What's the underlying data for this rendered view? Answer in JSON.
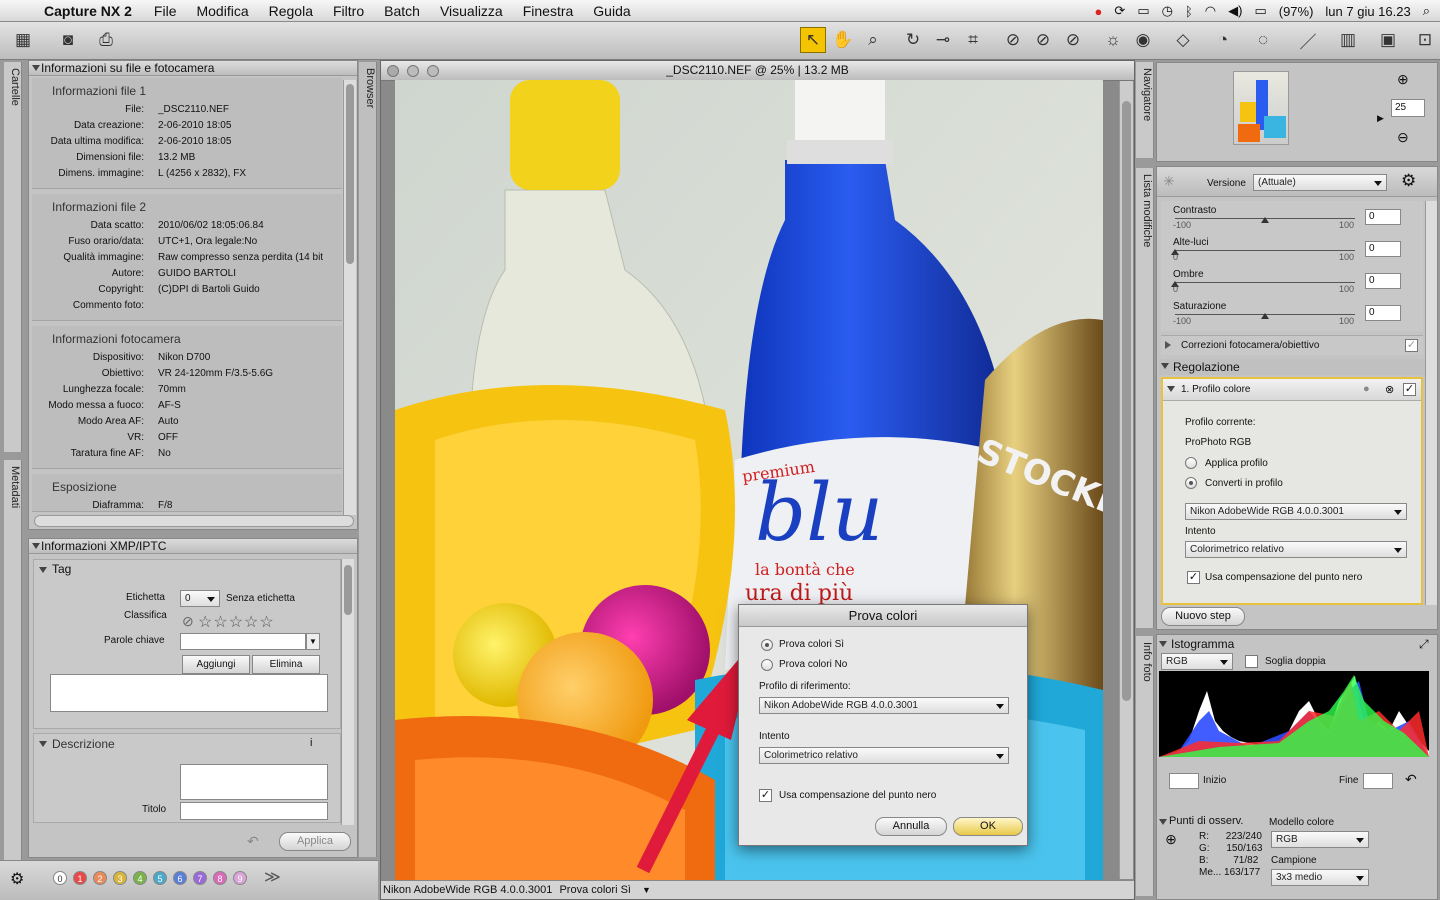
{
  "menubar": {
    "app": "Capture NX 2",
    "items": [
      "File",
      "Modifica",
      "Regola",
      "Filtro",
      "Batch",
      "Visualizza",
      "Finestra",
      "Guida"
    ],
    "battery": "(97%)",
    "datetime": "lun 7 giu  16.23"
  },
  "left_tabs": {
    "folders": "Cartelle",
    "metadata": "Metadati"
  },
  "browser_tab": "Browser",
  "file_info": {
    "header": "Informazioni su file e fotocamera",
    "sections": [
      {
        "title": "Informazioni file 1",
        "rows": [
          {
            "k": "File:",
            "v": "_DSC2110.NEF"
          },
          {
            "k": "Data creazione:",
            "v": "2-06-2010 18:05"
          },
          {
            "k": "Data ultima modifica:",
            "v": "2-06-2010 18:05"
          },
          {
            "k": "Dimensioni file:",
            "v": "13.2 MB"
          },
          {
            "k": "Dimens. immagine:",
            "v": "L (4256 x 2832), FX"
          }
        ]
      },
      {
        "title": "Informazioni file 2",
        "rows": [
          {
            "k": "Data scatto:",
            "v": "2010/06/02 18:05:06.84"
          },
          {
            "k": "Fuso orario/data:",
            "v": "UTC+1, Ora legale:No"
          },
          {
            "k": "Qualità immagine:",
            "v": "Raw compresso senza perdita (14 bit"
          },
          {
            "k": "Autore:",
            "v": "GUIDO BARTOLI"
          },
          {
            "k": "Copyright:",
            "v": "(C)DPI di Bartoli Guido"
          },
          {
            "k": "Commento foto:",
            "v": ""
          }
        ]
      },
      {
        "title": "Informazioni fotocamera",
        "rows": [
          {
            "k": "Dispositivo:",
            "v": "Nikon D700"
          },
          {
            "k": "Obiettivo:",
            "v": "VR 24-120mm F/3.5-5.6G"
          },
          {
            "k": "Lunghezza focale:",
            "v": "70mm"
          },
          {
            "k": "Modo messa a fuoco:",
            "v": "AF-S"
          },
          {
            "k": "Modo Area AF:",
            "v": "Auto"
          },
          {
            "k": "VR:",
            "v": "OFF"
          },
          {
            "k": "Taratura fine AF:",
            "v": "No"
          }
        ]
      },
      {
        "title": "Esposizione",
        "rows": [
          {
            "k": "Diaframma:",
            "v": "F/8"
          }
        ]
      }
    ]
  },
  "xmp": {
    "header": "Informazioni XMP/IPTC",
    "tag_title": "Tag",
    "label_label": "Etichetta",
    "label_value": "0",
    "label_text": "Senza etichetta",
    "rating_label": "Classifica",
    "rating_stars": "☆☆☆☆☆",
    "keywords_label": "Parole chiave",
    "add_button": "Aggiungi",
    "remove_button": "Elimina",
    "description_title": "Descrizione",
    "title_label": "Titolo",
    "apply_button": "Applica"
  },
  "label_dots": {
    "items": [
      "0",
      "1",
      "2",
      "3",
      "4",
      "5",
      "6",
      "7",
      "8",
      "9"
    ],
    "colors": [
      "#ffffff",
      "#e84a4a",
      "#e98a5a",
      "#d9b53a",
      "#79b24a",
      "#4aa9c9",
      "#5a7fd9",
      "#9a6ad9",
      "#d96ab7",
      "#d9a5d9"
    ]
  },
  "document": {
    "title": "_DSC2110.NEF @ 25% | 13.2 MB",
    "status_profile": "Nikon AdobeWide RGB 4.0.0.3001",
    "status_proof": "Prova colori Sì"
  },
  "navigator": {
    "tab": "Navigatore",
    "zoom": "25"
  },
  "edit_list": {
    "tab": "Lista modifiche",
    "version_label": "Versione",
    "version_value": "(Attuale)",
    "sliders": [
      {
        "label": "Contrasto",
        "min": "-100",
        "max": "100",
        "value": "0",
        "pos": 0.5
      },
      {
        "label": "Alte-luci",
        "min": "0",
        "max": "100",
        "value": "0",
        "pos": 0.0
      },
      {
        "label": "Ombre",
        "min": "0",
        "max": "100",
        "value": "0",
        "pos": 0.0
      },
      {
        "label": "Saturazione",
        "min": "-100",
        "max": "100",
        "value": "0",
        "pos": 0.5
      }
    ],
    "camera_corrections": "Correzioni fotocamera/obiettivo",
    "adjust_header": "Regolazione",
    "step_title": "1. Profilo colore",
    "current_profile_label": "Profilo corrente:",
    "current_profile_value": "ProPhoto RGB",
    "apply_profile": "Applica profilo",
    "convert_profile": "Converti in profilo",
    "profile_select": "Nikon AdobeWide RGB 4.0.0.3001",
    "intent_label": "Intento",
    "intent_select": "Colorimetrico relativo",
    "blackpoint": "Usa compensazione del punto nero",
    "new_step": "Nuovo step"
  },
  "photo_info": {
    "tab": "Info foto",
    "histogram_label": "Istogramma",
    "channel": "RGB",
    "double_threshold": "Soglia doppia",
    "start_label": "Inizio",
    "end_label": "Fine",
    "watch_points_label": "Punti di osserv.",
    "r_label": "R:",
    "r_value": "223/240",
    "g_label": "G:",
    "g_value": "150/163",
    "b_label": "B:",
    "b_value": "71/82",
    "me_label": "Me...",
    "me_value": "163/177",
    "color_model_label": "Modello colore",
    "color_model_value": "RGB",
    "sample_label": "Campione",
    "sample_value": "3x3 medio"
  },
  "dialog": {
    "title": "Prova colori",
    "opt_yes": "Prova colori Sì",
    "opt_no": "Prova colori No",
    "ref_profile_label": "Profilo di riferimento:",
    "ref_profile_value": "Nikon AdobeWide RGB 4.0.0.3001",
    "intent_label": "Intento",
    "intent_value": "Colorimetrico relativo",
    "blackpoint": "Usa compensazione del punto nero",
    "cancel": "Annulla",
    "ok": "OK"
  },
  "photo_texts": {
    "brand": "blu",
    "premium": "premium",
    "slogan1": "la bontà che",
    "slogan2": "ura di più",
    "can": "STOCKER"
  }
}
